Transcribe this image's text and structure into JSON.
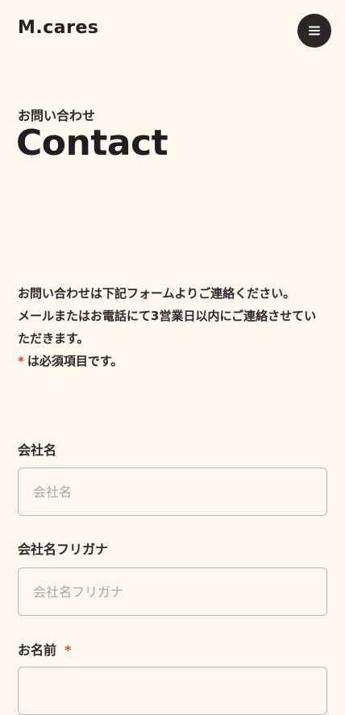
{
  "header": {
    "logo": "M.cares",
    "menu_icon": "hamburger-icon"
  },
  "page": {
    "subtitle": "お問い合わせ",
    "title": "Contact"
  },
  "intro": {
    "line1": "お問い合わせは下記フォームよりご連絡ください。",
    "line2": "メールまたはお電話にて3営業日以内にご連絡させていただきます。",
    "required_star": "*",
    "required_note": "は必須項目です。"
  },
  "form": {
    "company": {
      "label": "会社名",
      "placeholder": "会社名",
      "value": ""
    },
    "company_kana": {
      "label": "会社名フリガナ",
      "placeholder": "会社名フリガナ",
      "value": ""
    },
    "name": {
      "label": "お名前",
      "required_star": "*"
    }
  },
  "colors": {
    "background": "#fdf7ee",
    "text": "#2b2b2b",
    "required": "#e0443e",
    "menu_button": "#2a2826"
  }
}
